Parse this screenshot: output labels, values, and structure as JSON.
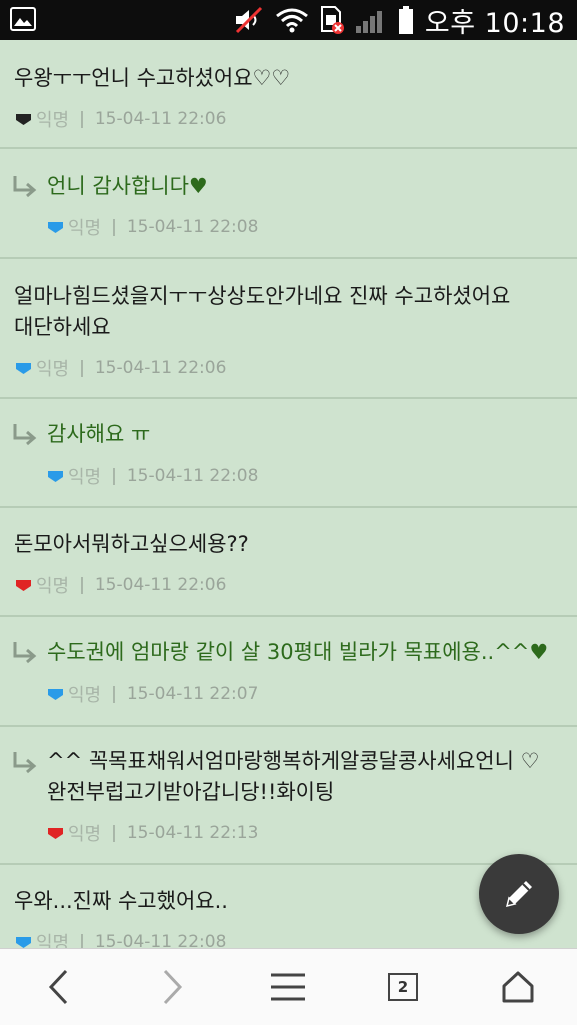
{
  "status_bar": {
    "time": "오후 10:18"
  },
  "comments": [
    {
      "type": "comment",
      "text_lines": [
        "우왕ㅜㅜ언니 수고하셨어요♡♡"
      ],
      "nickname": "익명",
      "timestamp": "15-04-11 22:06",
      "badge_color": "#222222"
    },
    {
      "type": "reply",
      "text_lines": [
        "언니 감사합니다♥"
      ],
      "nickname": "익명",
      "timestamp": "15-04-11 22:08",
      "badge_color": "#2a9be8"
    },
    {
      "type": "comment",
      "text_lines": [
        "얼마나힘드셨을지ㅜㅜ상상도안가네요 진짜 수고하셨어요",
        "대단하세요"
      ],
      "nickname": "익명",
      "timestamp": "15-04-11 22:06",
      "badge_color": "#2a9be8"
    },
    {
      "type": "reply",
      "text_lines": [
        "감사해요 ㅠ"
      ],
      "nickname": "익명",
      "timestamp": "15-04-11 22:08",
      "badge_color": "#2a9be8"
    },
    {
      "type": "comment",
      "text_lines": [
        "돈모아서뭐하고싶으세용??"
      ],
      "nickname": "익명",
      "timestamp": "15-04-11 22:06",
      "badge_color": "#e02424"
    },
    {
      "type": "reply",
      "text_lines": [
        "수도권에 엄마랑 같이 살 30평대 빌라가 목표에용..^^♥"
      ],
      "nickname": "익명",
      "timestamp": "15-04-11 22:07",
      "badge_color": "#2a9be8"
    },
    {
      "type": "reply-plain",
      "text_lines": [
        "^^ 꼭목표채워서엄마랑행복하게알콩달콩사세요언니 ♡",
        "완전부럽고기받아갑니당!!화이팅"
      ],
      "nickname": "익명",
      "timestamp": "15-04-11 22:13",
      "badge_color": "#e02424"
    },
    {
      "type": "comment",
      "text_lines": [
        "우와...진짜 수고했어요.."
      ],
      "nickname": "익명",
      "timestamp": "15-04-11 22:08",
      "badge_color": "#2a9be8"
    }
  ],
  "nav": {
    "tab_count": "2"
  }
}
